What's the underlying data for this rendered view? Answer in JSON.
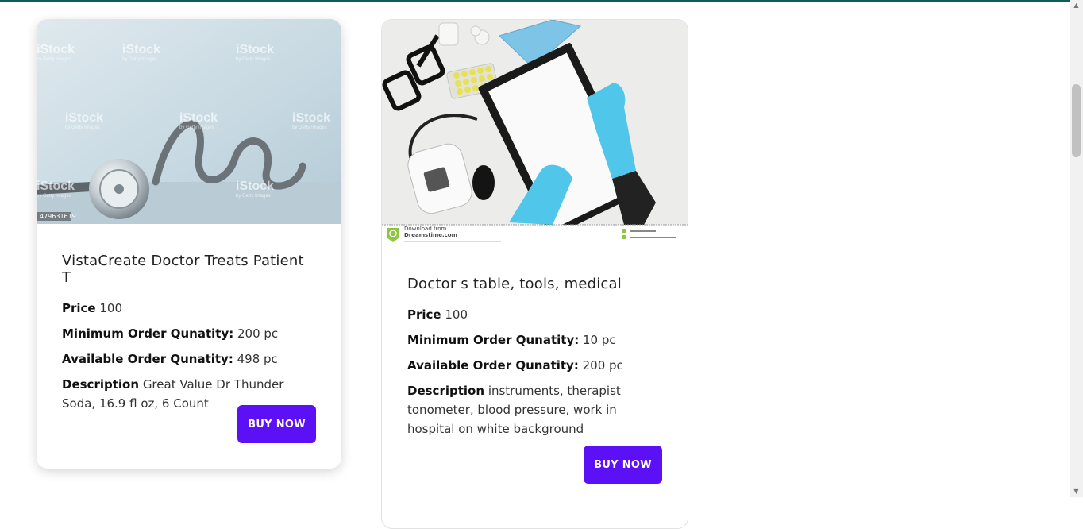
{
  "products": [
    {
      "title": "VistaCreate Doctor Treats Patient T",
      "price_label": "Price",
      "price": "100",
      "min_order_label": "Minimum Order Qunatity:",
      "min_order": "200 pc",
      "available_label": "Available Order Qunatity:",
      "available": "498 pc",
      "description_label": "Description",
      "description": "Great Value Dr Thunder Soda, 16.9 fl oz, 6 Count",
      "buy_label": "BUY NOW",
      "image": {
        "watermark": "iStock",
        "watermark_sub": "by Getty Images",
        "stock_id": "479631619"
      }
    },
    {
      "title": "Doctor s table, tools, medical",
      "price_label": "Price",
      "price": "100",
      "min_order_label": "Minimum Order Qunatity:",
      "min_order": "10 pc",
      "available_label": "Available Order Qunatity:",
      "available": "200 pc",
      "description_label": "Description",
      "description": "instruments, therapist tonometer, blood pressure, work in hospital on white background",
      "buy_label": "BUY NOW",
      "image": {
        "download_from": "Download from",
        "source": "Dreamstime.com"
      }
    }
  ],
  "colors": {
    "accent": "#5b10f5",
    "top_line": "#0d5d5f"
  }
}
